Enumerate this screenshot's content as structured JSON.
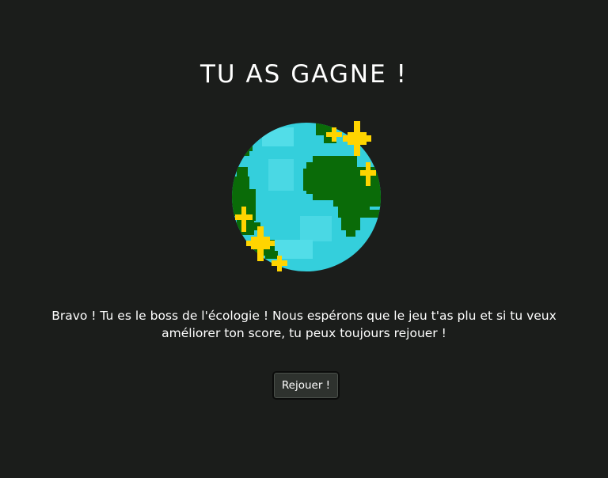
{
  "screen": {
    "title": "TU AS GAGNE !",
    "message": "Bravo ! Tu es le boss de l'écologie ! Nous espérons que le jeu t'as plu et si tu veux améliorer ton score, tu peux toujours rejouer !",
    "replay_label": "Rejouer !"
  },
  "earth": {
    "icon": "earth-icon",
    "colors": {
      "ocean": "#34cfdc",
      "ocean_light": "#52dde8",
      "land": "#0a6b08",
      "sparkle": "#ffd400"
    }
  },
  "colors": {
    "background": "#1b1d1b",
    "text": "#ffffff",
    "button_bg": "#2e322e"
  }
}
